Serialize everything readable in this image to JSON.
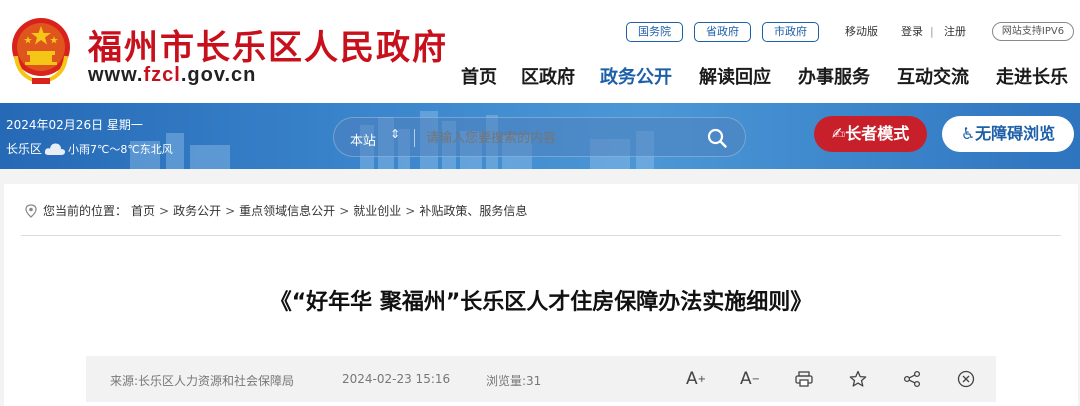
{
  "header": {
    "site_name": "福州市长乐区人民政府",
    "domain_prefix": "www.",
    "domain_highlight": "fzcl",
    "domain_suffix": ".gov.cn",
    "top_links": [
      "国务院",
      "省政府",
      "市政府"
    ],
    "mobile": "移动版",
    "login": "登录",
    "separator": "|",
    "register": "注册",
    "ipv6": "网站支持IPV6",
    "nav": [
      "首页",
      "区政府",
      "政务公开",
      "解读回应",
      "办事服务",
      "互动交流",
      "走进长乐"
    ],
    "active_nav": "政务公开",
    "accent_color": "#c8101c",
    "brand_blue": "#1d5fa8"
  },
  "bar": {
    "date": "2024年02月26日 星期一",
    "location": "长乐区",
    "weather_icon": "cloud-icon",
    "weather": "小雨7℃～8℃东北风",
    "search_scope": "本站",
    "search_placeholder": "请输入您要搜索的内容",
    "elder_mode": "长者模式",
    "accessibility": "无障碍浏览"
  },
  "breadcrumb": {
    "prefix": "您当前的位置：",
    "items": [
      "首页",
      "政务公开",
      "重点领域信息公开",
      "就业创业",
      "补贴政策、服务信息"
    ],
    "separator": ">"
  },
  "article": {
    "title": "《“好年华 聚福州”长乐区人才住房保障办法实施细则》",
    "source": "来源:长乐区人力资源和社会保障局",
    "date": "2024-02-23 15:16",
    "views": "浏览量:31",
    "font_larger": "A",
    "font_smaller": "A",
    "plus": "+",
    "minus": "−"
  }
}
